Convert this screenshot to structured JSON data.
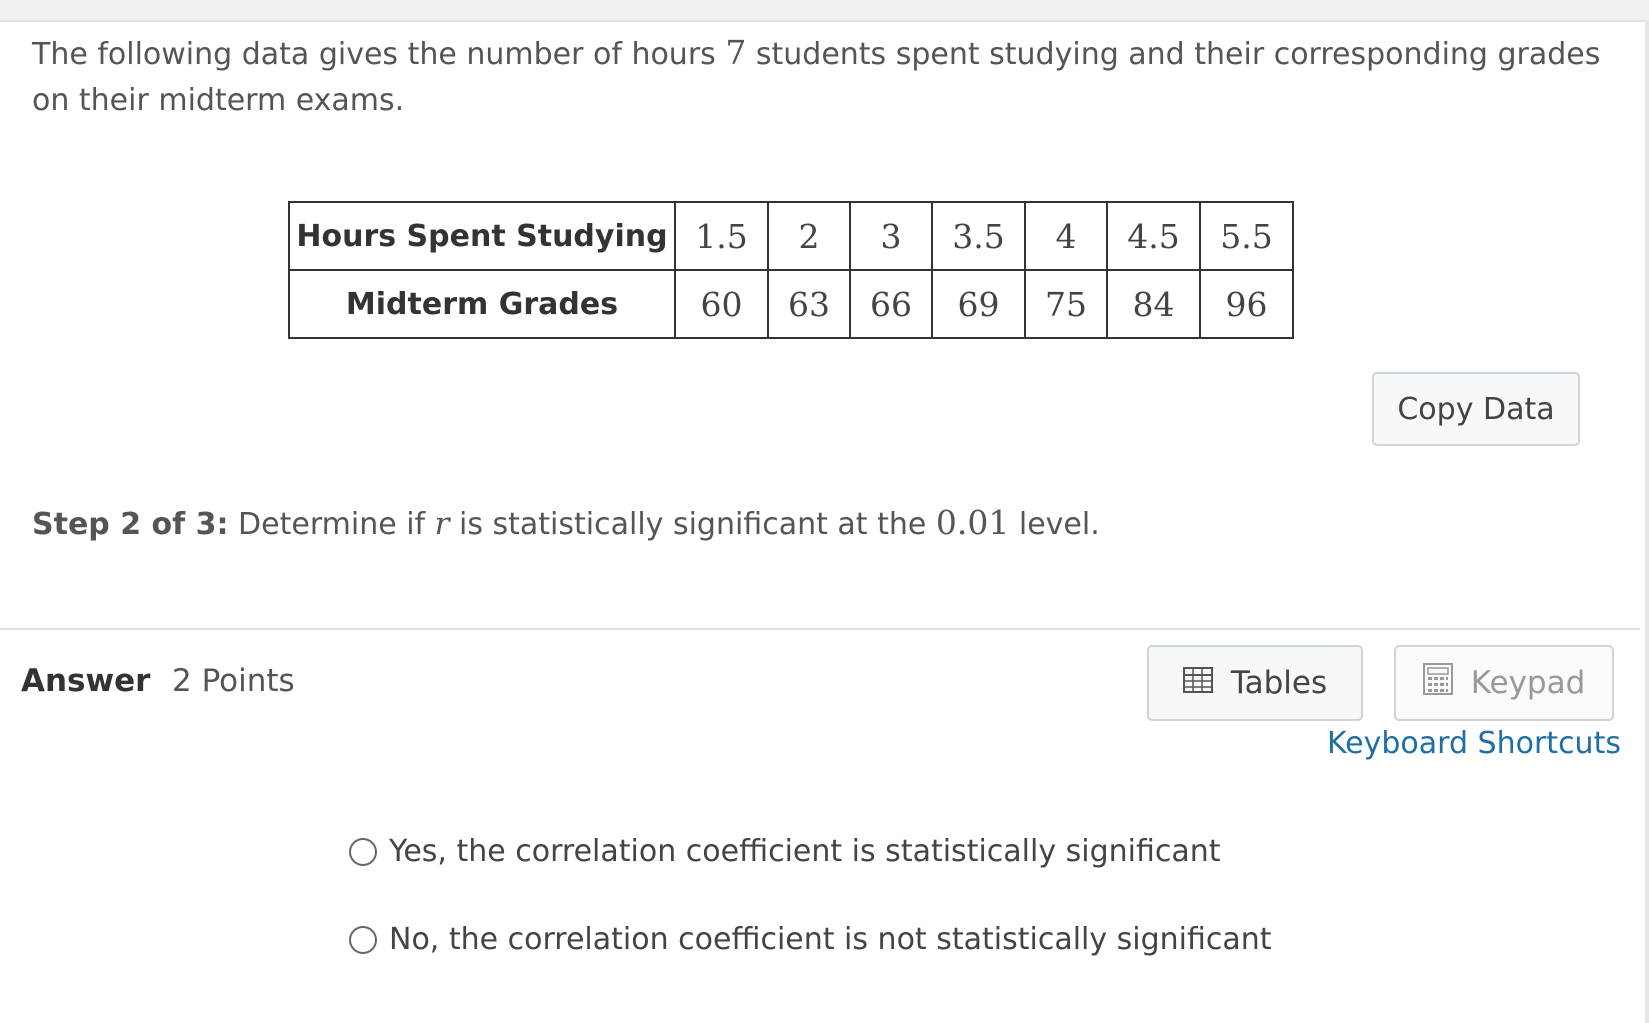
{
  "question": {
    "text_before": "The following data gives the number of hours ",
    "count": "7",
    "text_after": " students spent studying and their corresponding grades on their midterm exams."
  },
  "table": {
    "row1_header": "Hours Spent Studying",
    "row1_values": [
      "1.5",
      "2",
      "3",
      "3.5",
      "4",
      "4.5",
      "5.5"
    ],
    "row2_header": "Midterm Grades",
    "row2_values": [
      "60",
      "63",
      "66",
      "69",
      "75",
      "84",
      "96"
    ]
  },
  "copy_button": "Copy Data",
  "step": {
    "label": "Step 2 of 3:",
    "text_before": " Determine if ",
    "variable": "r",
    "text_middle": " is statistically significant at the ",
    "level": "0.01",
    "text_after": " level."
  },
  "answer": {
    "label": "Answer",
    "points": "2 Points",
    "tables_button": "Tables",
    "keypad_button": "Keypad",
    "shortcuts_link": "Keyboard Shortcuts"
  },
  "options": [
    "Yes, the correlation coefficient is statistically significant",
    "No, the correlation coefficient is not statistically significant"
  ],
  "icons": {
    "tables": "table-grid-icon",
    "keypad": "calculator-icon"
  }
}
